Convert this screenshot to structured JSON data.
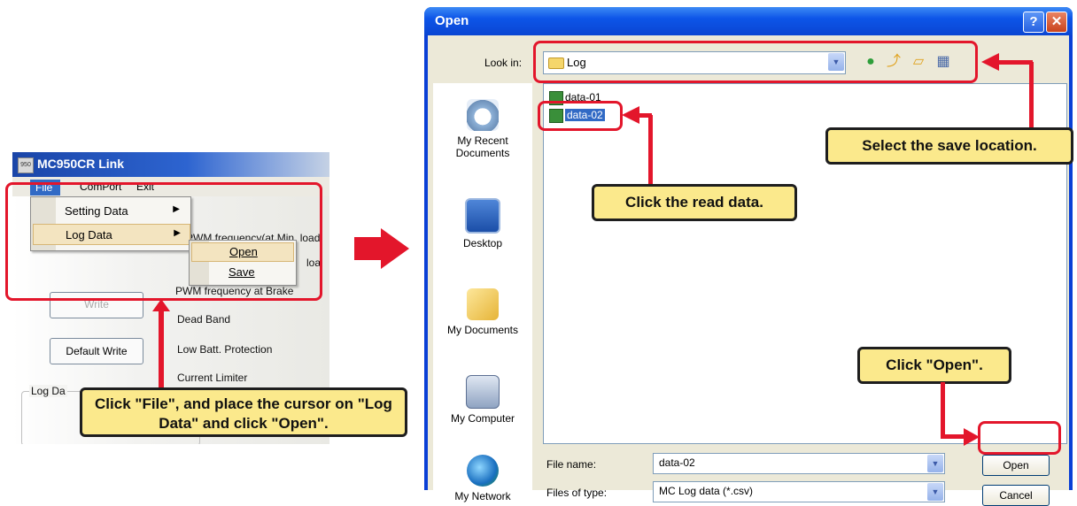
{
  "left_app": {
    "title": "MC950CR Link",
    "icon_text": "950",
    "menubar": [
      "File",
      "ComPort",
      "Exit"
    ],
    "file_menu": {
      "items": [
        "Setting Data",
        "Log Data"
      ],
      "log_submenu": [
        "Open",
        "Save"
      ]
    },
    "background_labels": [
      "PWM frequency(at Min. load",
      "loa",
      "PWM frequency at Brake",
      "Dead Band",
      "Low Batt. Protection",
      "Current Limiter",
      "Log Da"
    ],
    "write_button": "Write",
    "default_write_button": "Default Write"
  },
  "callouts": {
    "left": "Click \"File\", and place the cursor on \"Log Data\" and click \"Open\".",
    "read_data": "Click the read data.",
    "save_location": "Select the save location.",
    "open": "Click \"Open\"."
  },
  "dialog": {
    "title": "Open",
    "help_glyph": "?",
    "close_glyph": "✕",
    "look_in_label": "Look in:",
    "look_in_value": "Log",
    "places": [
      "My Recent Documents",
      "Desktop",
      "My Documents",
      "My Computer",
      "My Network"
    ],
    "files": [
      "data-01",
      "data-02"
    ],
    "selected_file": "data-02",
    "file_name_label": "File name:",
    "file_name_value": "data-02",
    "file_type_label": "Files of type:",
    "file_type_value": "MC Log data (*.csv)",
    "open_button": "Open",
    "cancel_button": "Cancel"
  },
  "colors": {
    "highlight_red": "#e3162b",
    "callout_fill": "#fbe98c",
    "xp_titlebar": "#0a45d2",
    "selection": "#316ac5"
  }
}
